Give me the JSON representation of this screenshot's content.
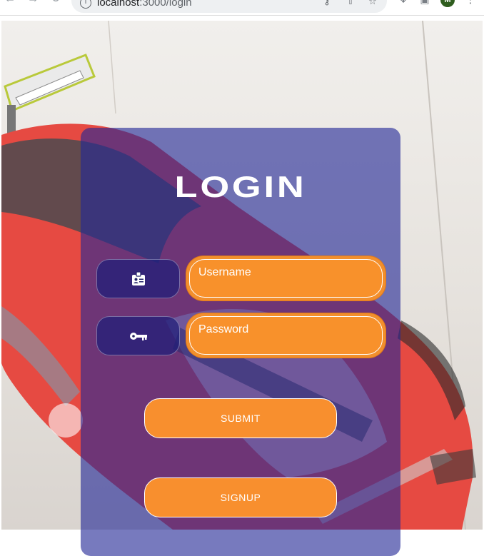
{
  "browser": {
    "url_host": "localhost",
    "url_port_path": ":3000/login",
    "profile_initial": "M"
  },
  "login": {
    "title": "LOGIN",
    "username_placeholder": "Username",
    "password_placeholder": "Password",
    "submit_label": "SUBMIT",
    "signup_label": "SIGNUP",
    "icons": {
      "username": "id-badge-icon",
      "password": "key-icon"
    }
  },
  "colors": {
    "card": "#23289e",
    "field": "#f28f2c",
    "button": "#f88f2e",
    "text": "#ffffff"
  }
}
